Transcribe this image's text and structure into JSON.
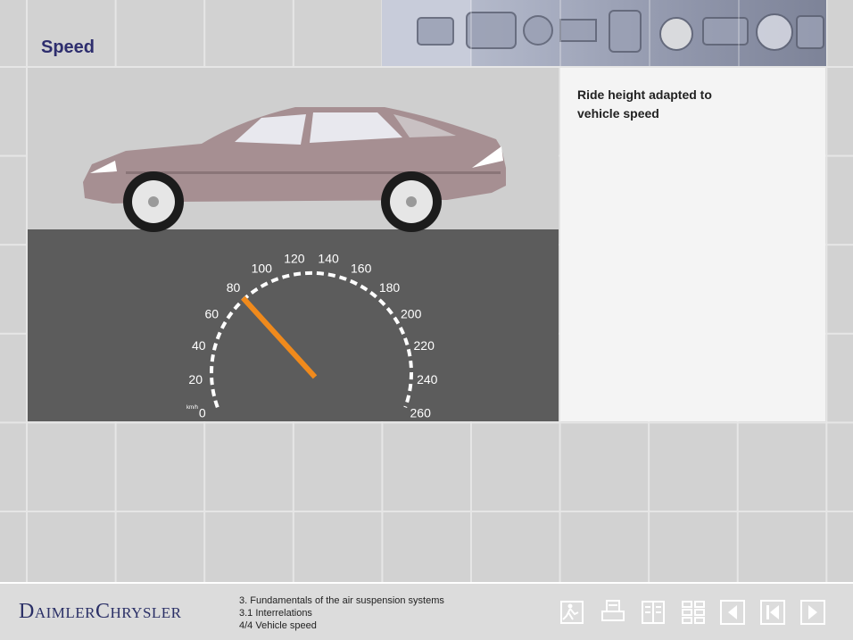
{
  "page": {
    "title": "Speed"
  },
  "info_panel": {
    "text": "Ride height adapted to vehicle speed"
  },
  "speedometer": {
    "unit": "km/h",
    "tick_labels": [
      "0",
      "20",
      "40",
      "60",
      "80",
      "100",
      "120",
      "140",
      "160",
      "180",
      "200",
      "220",
      "240",
      "260"
    ],
    "current_speed": 80,
    "needle_color": "#f08a1c"
  },
  "footer": {
    "logo": "DaimlerChrysler",
    "breadcrumb": [
      "3. Fundamentals of the air suspension systems",
      "3.1 Interrelations",
      "4/4 Vehicle speed"
    ],
    "nav_icons": [
      "exit-icon",
      "print-icon",
      "glossary-icon",
      "contents-icon",
      "previous-icon",
      "first-page-icon",
      "next-icon"
    ]
  },
  "colors": {
    "title": "#2e2e6e",
    "car_body": "#a68f92",
    "road": "#5c5c5c",
    "background": "#d2d2d2"
  }
}
